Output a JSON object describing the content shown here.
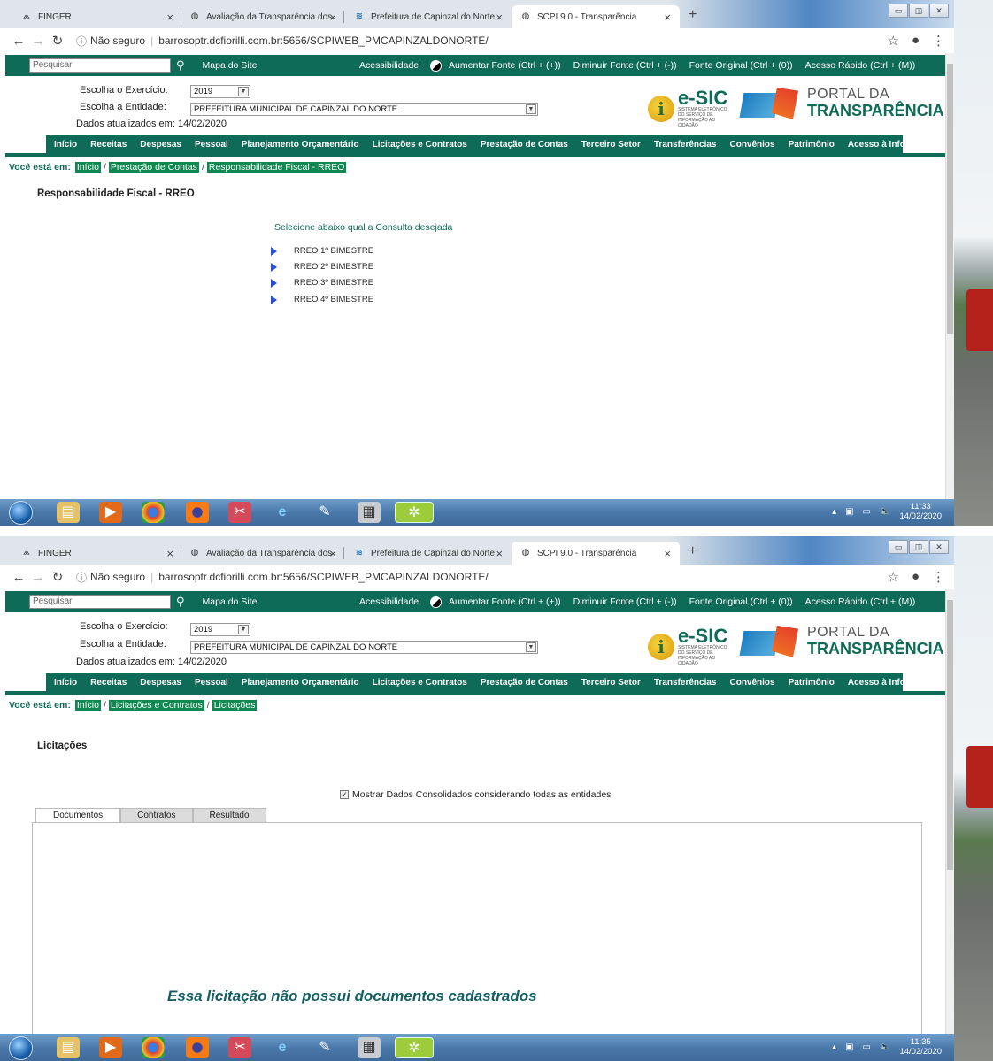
{
  "browser": {
    "tabs": [
      {
        "title": "FINGER",
        "icon": "finger-icon"
      },
      {
        "title": "Avaliação da Transparência dos",
        "icon": "globe-icon"
      },
      {
        "title": "Prefeitura de Capinzal do Norte",
        "icon": "site-icon"
      },
      {
        "title": "SCPI 9.0 - Transparência",
        "icon": "globe-icon"
      }
    ],
    "new_tab": "+",
    "address": {
      "security": "Não seguro",
      "url": "barrosoptr.dcfiorilli.com.br:5656/SCPIWEB_PMCAPINZALDONORTE/"
    }
  },
  "site": {
    "search_placeholder": "Pesquisar",
    "mapa": "Mapa do Site",
    "accessibility_label": "Acessibilidade:",
    "accessibility_items": [
      "Aumentar Fonte (Ctrl + (+))",
      "Diminuir Fonte (Ctrl + (-))",
      "Fonte Original (Ctrl + (0))",
      "Acesso Rápido (Ctrl + (M))"
    ],
    "exercicio_label": "Escolha o Exercício:",
    "exercicio_value": "2019",
    "entidade_label": "Escolha a Entidade:",
    "entidade_value": "PREFEITURA MUNICIPAL DE CAPINZAL DO NORTE",
    "atualizados": "Dados atualizados em: 14/02/2020",
    "esic_big": "e-SIC",
    "esic_small": "SISTEMA ELETRÔNICO DO SERVIÇO DE INFORMAÇÃO AO CIDADÃO",
    "portal_line1": "PORTAL DA",
    "portal_line2": "TRANSPARÊNCIA",
    "menu": [
      "Início",
      "Receitas",
      "Despesas",
      "Pessoal",
      "Planejamento Orçamentário",
      "Licitações e Contratos",
      "Prestação de Contas",
      "Terceiro Setor",
      "Transferências",
      "Convênios",
      "Patrimônio",
      "Acesso à Informação"
    ],
    "breadcrumb_label": "Você está em:"
  },
  "shot1": {
    "breadcrumb": [
      "Início",
      "Prestação de Contas",
      "Responsabilidade Fiscal - RREO"
    ],
    "title": "Responsabilidade Fiscal - RREO",
    "prompt": "Selecione abaixo qual a Consulta desejada",
    "items": [
      "RREO 1º BIMESTRE",
      "RREO 2º BIMESTRE",
      "RREO 3º BIMESTRE",
      "RREO 4º BIMESTRE"
    ],
    "clock_time": "11:33",
    "clock_date": "14/02/2020"
  },
  "shot2": {
    "breadcrumb": [
      "Início",
      "Licitações e Contratos",
      "Licitações"
    ],
    "title": "Licitações",
    "checkbox_label": "Mostrar Dados Consolidados considerando todas as entidades",
    "tabs": [
      "Documentos",
      "Contratos",
      "Resultado"
    ],
    "empty_message": "Essa licitação não possui documentos cadastrados",
    "clock_time": "11:35",
    "clock_date": "14/02/2020"
  },
  "colors": {
    "site_green": "#0e6b57",
    "crumb_green": "#0e8a50",
    "taskbar_blue": "#4a78aa"
  }
}
